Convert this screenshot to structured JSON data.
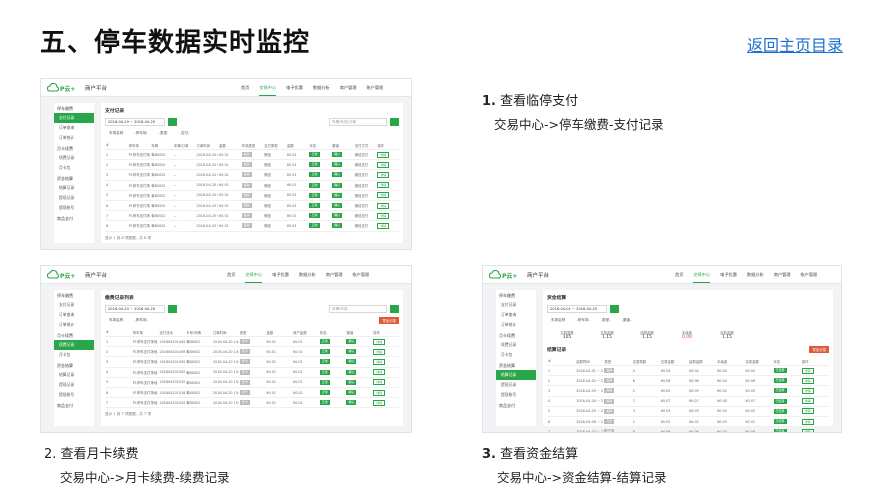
{
  "title": "五、停车数据实时监控",
  "home_link": "返回主页目录",
  "steps": [
    {
      "num": "1.",
      "label": "查看临停支付",
      "path": "交易中心->停车缴费-支付记录"
    },
    {
      "num": "2.",
      "label": "查看月卡续费",
      "path": "交易中心->月卡续费-续费记录"
    },
    {
      "num": "3.",
      "label": "查看资金结算",
      "path": "交易中心->资金结算-结算记录"
    }
  ],
  "app": {
    "logo": "P云+",
    "platform": "商户平台",
    "nav": [
      "首页",
      "交易中心",
      "电子优惠",
      "数据分析",
      "商户管理",
      "账户管理"
    ],
    "active_nav": "交易中心"
  },
  "shot1": {
    "sidebar": [
      {
        "group": "停车缴费",
        "items": [
          "支付记录",
          "订单查询",
          "订单统计"
        ]
      },
      {
        "group": "月卡续费",
        "items": [
          "续费记录",
          "月卡包"
        ]
      },
      {
        "group": "资金结算",
        "items": [
          "结算记录",
          "提现记录",
          "提现账号"
        ]
      },
      {
        "group": "商品支付",
        "items": []
      }
    ],
    "active_item": "支付记录",
    "panel_title": "支付记录",
    "date_range": "2016-04-19 ~ 2016-04-20",
    "search_placeholder": "车牌/车场/订单",
    "filters": [
      "车场名称",
      "-停车场-",
      "-类型-",
      "-支付-"
    ],
    "headers": [
      "#",
      "停车场",
      "车牌",
      "车牌/订单",
      "订单时间",
      "金额",
      "车场类型",
      "支付类型",
      "金额",
      "状态",
      "渠道",
      "支付方式",
      "操作"
    ],
    "rows": [
      [
        "1",
        "P1停车支付场地-停车场",
        "粤B0002",
        "--",
        "2016-04-20 09:40:53",
        "¥0.01",
        "临停",
        "微信",
        "¥0.01",
        "正常",
        "确认",
        "微信支付",
        "详情"
      ],
      [
        "2",
        "P1停车支付场地-停车场",
        "粤B0002",
        "--",
        "2016-04-20 09:41:00",
        "¥0.01",
        "临停",
        "微信",
        "¥0.01",
        "正常",
        "确认",
        "微信支付",
        "详情"
      ],
      [
        "3",
        "P1停车支付场地-停车场",
        "粤B0002",
        "--",
        "2016-04-20 09:41:09",
        "¥0.01",
        "临停",
        "微信",
        "¥0.01",
        "正常",
        "确认",
        "微信支付",
        "详情"
      ],
      [
        "4",
        "P1停车支付场地-停车场",
        "粤B0002",
        "--",
        "2016-04-20 09:41:21",
        "¥0.01",
        "临停",
        "微信",
        "¥0.01",
        "正常",
        "确认",
        "微信支付",
        "详情"
      ],
      [
        "5",
        "P1停车支付场地-停车场",
        "粤B0002",
        "--",
        "2016-04-20 09:41:33",
        "¥0.01",
        "临停",
        "微信",
        "¥0.01",
        "正常",
        "确认",
        "微信支付",
        "详情"
      ],
      [
        "6",
        "P1停车支付场地-停车场",
        "粤B0002",
        "--",
        "2016-04-20 09:42:04",
        "¥0.01",
        "临停",
        "微信",
        "¥0.01",
        "正常",
        "确认",
        "微信支付",
        "详情"
      ],
      [
        "7",
        "P1停车支付场地-停车场",
        "粤B0002",
        "--",
        "2016-04-20 09:42:10",
        "¥0.01",
        "临停",
        "微信",
        "¥0.01",
        "正常",
        "确认",
        "微信支付",
        "详情"
      ],
      [
        "8",
        "P1停车支付场地-停车场",
        "粤B0002",
        "--",
        "2016-04-20 09:42:30",
        "¥0.01",
        "临停",
        "微信",
        "¥0.01",
        "正常",
        "确认",
        "微信支付",
        "详情"
      ]
    ],
    "pager": "显示 1 到 8 项数据，共 8 项"
  },
  "shot2": {
    "sidebar": [
      {
        "group": "停车缴费",
        "items": [
          "支付记录",
          "订单查询",
          "订单统计"
        ]
      },
      {
        "group": "月卡续费",
        "items": [
          "续费记录",
          "月卡包"
        ]
      },
      {
        "group": "资金结算",
        "items": [
          "结算记录",
          "提现记录",
          "提现账号"
        ]
      },
      {
        "group": "商品支付",
        "items": []
      }
    ],
    "active_item": "续费记录",
    "panel_title": "缴费记录列表",
    "date_range": "2016-04-20 ~ 2016-04-20",
    "search_placeholder": "车牌/车场",
    "filters": [
      "车场名称",
      "-停车场-"
    ],
    "headers": [
      "#",
      "停车场",
      "支付流水",
      "卡号/车牌",
      "订单时间",
      "类型",
      "金额",
      "商户金额",
      "状态",
      "渠道",
      "操作"
    ],
    "rows": [
      [
        "1",
        "P1停车支付场地-停车场",
        "2016042014450251",
        "粤B0002",
        "2016-04-20 14:45",
        "月卡",
        "¥0.01",
        "¥0.01",
        "正常",
        "确认",
        "详情"
      ],
      [
        "2",
        "P1停车支付场地-停车场",
        "2016042014492031",
        "粤B0002",
        "2016-04-20 14:49",
        "月卡",
        "¥0.01",
        "¥0.01",
        "正常",
        "确认",
        "详情"
      ],
      [
        "3",
        "P1停车支付场地-停车场",
        "2016042014551123",
        "粤B0002",
        "2016-04-20 14:55",
        "月卡",
        "¥0.01",
        "¥0.01",
        "正常",
        "确认",
        "详情"
      ],
      [
        "4",
        "P1停车支付场地-停车场",
        "2016042015024409",
        "粤B0002",
        "2016-04-20 15:02",
        "月卡",
        "¥0.01",
        "¥0.01",
        "正常",
        "确认",
        "详情"
      ],
      [
        "5",
        "P1停车支付场地-停车场",
        "2016042015103377",
        "粤B0002",
        "2016-04-20 15:10",
        "月卡",
        "¥0.01",
        "¥0.01",
        "正常",
        "确认",
        "详情"
      ],
      [
        "6",
        "P1停车支付场地-停车场",
        "2016042015182260",
        "粤B0002",
        "2016-04-20 15:18",
        "月卡",
        "¥0.01",
        "¥0.01",
        "正常",
        "确认",
        "详情"
      ],
      [
        "7",
        "P1停车支付场地-停车场",
        "2016042015250318",
        "粤B0002",
        "2016-04-20 15:25",
        "月卡",
        "¥0.01",
        "¥0.01",
        "正常",
        "确认",
        "详情"
      ]
    ],
    "export_label": "导出记录",
    "pager": "显示 1 到 7 项数据，共 7 项"
  },
  "shot3": {
    "sidebar": [
      {
        "group": "停车缴费",
        "items": [
          "支付记录",
          "订单查询",
          "订单统计"
        ]
      },
      {
        "group": "月卡续费",
        "items": [
          "续费记录",
          "月卡包"
        ]
      },
      {
        "group": "资金结算",
        "items": [
          "结算记录",
          "提现记录",
          "提现账号"
        ]
      },
      {
        "group": "商品支付",
        "items": []
      }
    ],
    "active_item": "结算记录",
    "panel_title": "资金结算",
    "date_range": "2016-04-01 ~ 2016-04-20",
    "filters": [
      "车场名称",
      "-停车场-",
      "-类型-",
      "-渠道-"
    ],
    "stats": [
      {
        "label": "交易笔数",
        "value": "105"
      },
      {
        "label": "交易金额",
        "value": "1.15"
      },
      {
        "label": "结算金额",
        "value": "1.15"
      },
      {
        "label": "手续费",
        "value": "0.00",
        "red": true
      },
      {
        "label": "实收金额",
        "value": "1.15"
      }
    ],
    "list_title": "结算记录",
    "export_label": "导出记录",
    "headers": [
      "#",
      "结算时间",
      "类型",
      "交易笔数",
      "交易金额",
      "结算金额",
      "手续费",
      "实收金额",
      "状态",
      "操作"
    ],
    "rows": [
      [
        "1",
        "2016-04-01 ~ 2016-04-01",
        "临停",
        "4",
        "¥0.04",
        "¥0.04",
        "¥0.00",
        "¥0.04",
        "已结算",
        "详情"
      ],
      [
        "2",
        "2016-04-02 ~ 2016-04-02",
        "临停",
        "6",
        "¥0.06",
        "¥0.06",
        "¥0.00",
        "¥0.06",
        "已结算",
        "详情"
      ],
      [
        "3",
        "2016-04-03 ~ 2016-04-03",
        "临停",
        "5",
        "¥0.05",
        "¥0.05",
        "¥0.00",
        "¥0.05",
        "已结算",
        "详情"
      ],
      [
        "4",
        "2016-04-04 ~ 2016-04-04",
        "临停",
        "7",
        "¥0.07",
        "¥0.07",
        "¥0.00",
        "¥0.07",
        "已结算",
        "详情"
      ],
      [
        "5",
        "2016-04-05 ~ 2016-04-05",
        "临停",
        "3",
        "¥0.03",
        "¥0.03",
        "¥0.00",
        "¥0.03",
        "已结算",
        "详情"
      ],
      [
        "6",
        "2016-04-06 ~ 2016-04-06",
        "月卡",
        "2",
        "¥0.02",
        "¥0.02",
        "¥0.00",
        "¥0.02",
        "已结算",
        "详情"
      ],
      [
        "7",
        "2016-04-07 ~ 2016-04-07",
        "临停",
        "8",
        "¥0.08",
        "¥0.08",
        "¥0.00",
        "¥0.08",
        "已结算",
        "详情"
      ],
      [
        "8",
        "2016-04-08 ~ 2016-04-08",
        "临停",
        "5",
        "¥0.05",
        "¥0.05",
        "¥0.00",
        "¥0.05",
        "已结算",
        "详情"
      ],
      [
        "9",
        "2016-04-09 ~ 2016-04-09",
        "临停",
        "6",
        "¥0.06",
        "¥0.06",
        "¥0.00",
        "¥0.06",
        "已结算",
        "详情"
      ]
    ]
  }
}
